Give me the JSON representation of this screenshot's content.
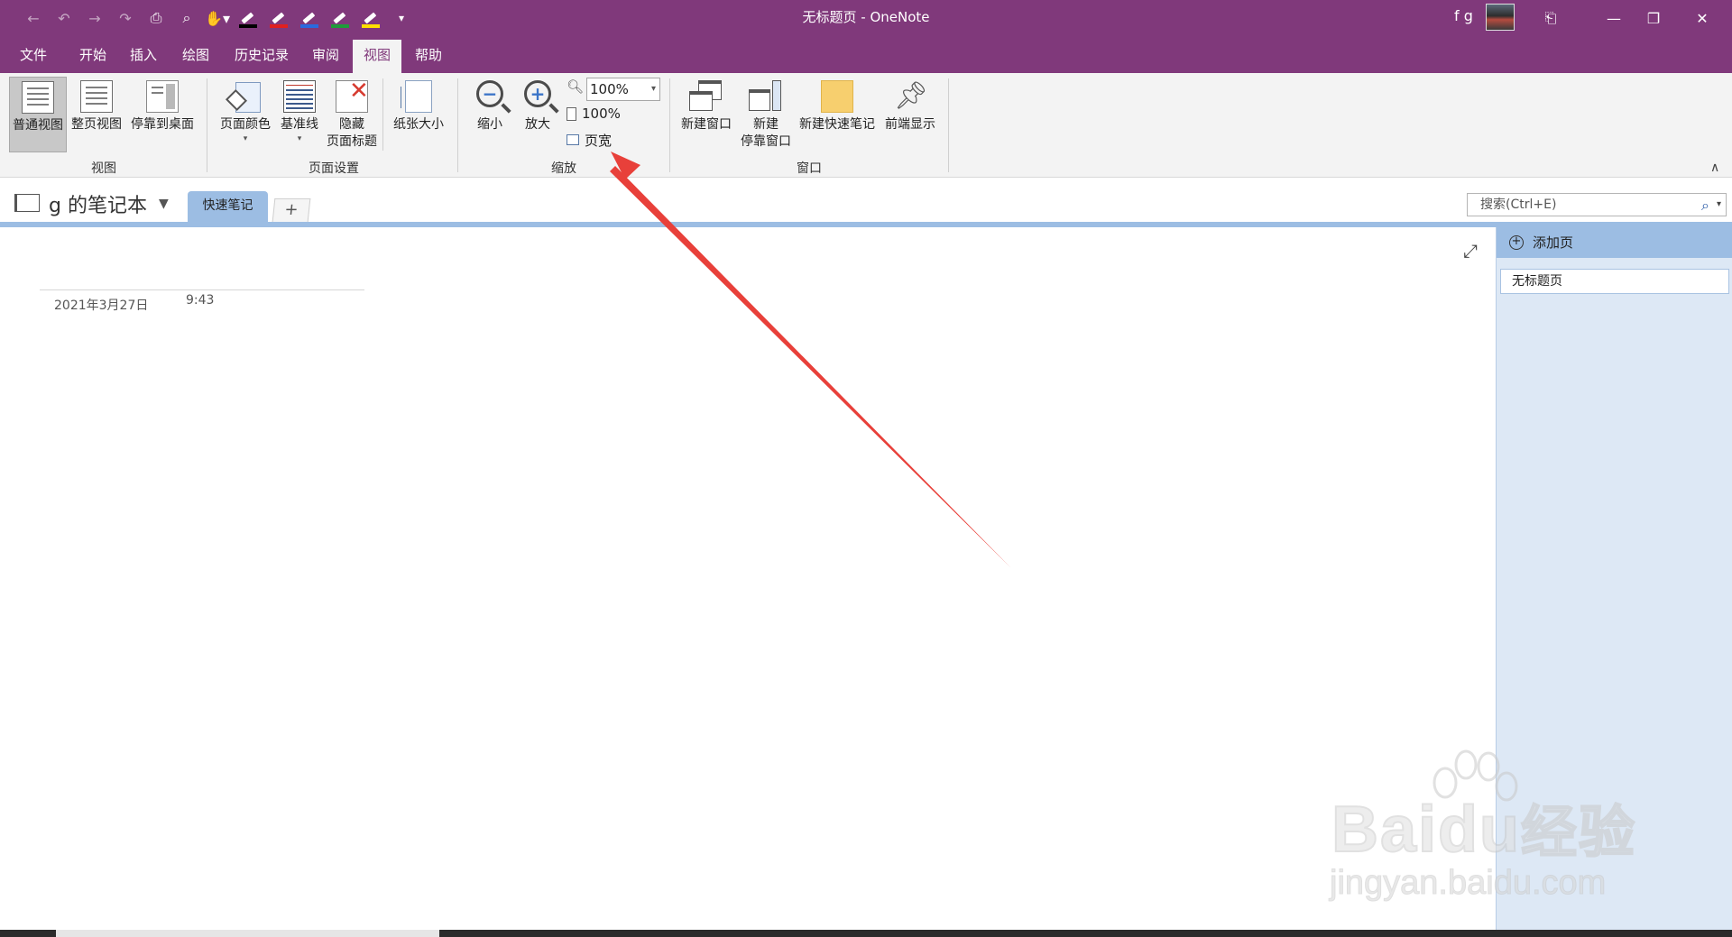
{
  "window": {
    "title": "无标题页 - OneNote",
    "user": "f g"
  },
  "colors": {
    "accent": "#80397b",
    "section_tab": "#9cbde3",
    "page_pane": "#dde8f5",
    "arrow": "#e8403a"
  },
  "quick_access": [
    "back-icon",
    "undo-icon",
    "forward-icon",
    "redo-icon",
    "print-icon",
    "print-preview-icon",
    "touch-mode-icon",
    "pen-black-icon",
    "pen-red-icon",
    "pen-blue-icon",
    "pen-green-icon",
    "highlighter-yellow-icon",
    "customize-icon"
  ],
  "menu": {
    "tabs": [
      "文件",
      "开始",
      "插入",
      "绘图",
      "历史记录",
      "审阅",
      "视图",
      "帮助"
    ],
    "active": "视图"
  },
  "ribbon": {
    "view": {
      "normal": "普通视图",
      "full_page": "整页视图",
      "dock": "停靠到桌面",
      "label": "视图"
    },
    "page_setup": {
      "page_color": "页面颜色",
      "rule_lines": "基准线",
      "hide_title_1": "隐藏",
      "hide_title_2": "页面标题",
      "paper_size": "纸张大小",
      "label": "页面设置"
    },
    "zoom": {
      "zoom_out": "缩小",
      "zoom_in": "放大",
      "zoom_value": "100%",
      "reset": "100%",
      "page_width": "页宽",
      "label": "缩放"
    },
    "window": {
      "new_window": "新建窗口",
      "new_docked_1": "新建",
      "new_docked_2": "停靠窗口",
      "new_quick_note": "新建快速笔记",
      "always_on_top": "前端显示",
      "label": "窗口"
    }
  },
  "notebook": {
    "name": "g 的笔记本",
    "section": "快速笔记",
    "add_section": "+",
    "search_placeholder": "搜索(Ctrl+E)"
  },
  "page": {
    "date": "2021年3月27日",
    "time": "9:43"
  },
  "page_pane": {
    "add_page": "添加页",
    "pages": [
      "无标题页"
    ]
  },
  "watermark": {
    "brand": "Bai",
    "brand_end": "du",
    "brand_cn": "经验",
    "url": "jingyan.baidu.com"
  }
}
